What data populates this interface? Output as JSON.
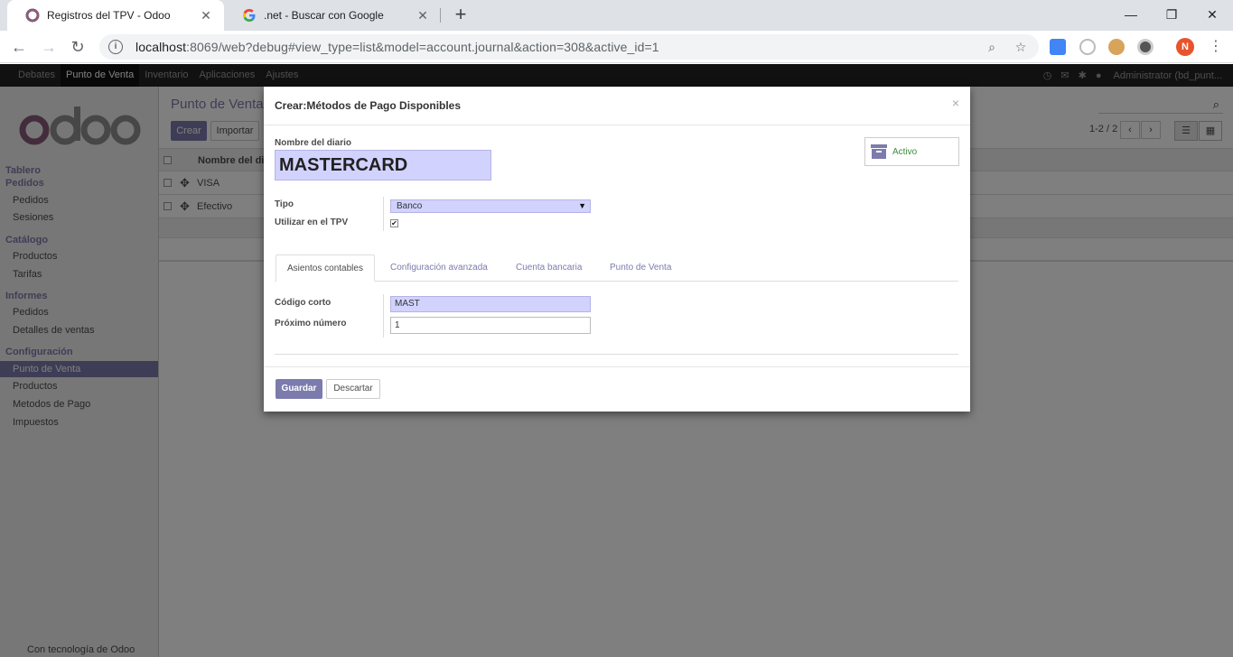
{
  "browser": {
    "tabs": [
      {
        "title": "Registros del TPV - Odoo",
        "active": true
      },
      {
        "title": ".net - Buscar con Google",
        "active": false
      }
    ],
    "url_host": "localhost",
    "url_rest": ":8069/web?debug#view_type=list&model=account.journal&action=308&active_id=1",
    "profile_initial": "N"
  },
  "topnav": {
    "items": [
      "Debates",
      "Punto de Venta",
      "Inventario",
      "Aplicaciones",
      "Ajustes"
    ],
    "active_index": 1,
    "user": "Administrator (bd_punt..."
  },
  "sidebar": {
    "sections": [
      {
        "label": "Tablero"
      },
      {
        "label": "Pedidos",
        "items": [
          "Pedidos",
          "Sesiones"
        ]
      },
      {
        "label": "Catálogo",
        "items": [
          "Productos",
          "Tarifas"
        ]
      },
      {
        "label": "Informes",
        "items": [
          "Pedidos",
          "Detalles de ventas"
        ]
      },
      {
        "label": "Configuración",
        "items": [
          "Punto de Venta",
          "Productos",
          "Metodos de Pago",
          "Impuestos"
        ]
      }
    ],
    "active_item": "Punto de Venta",
    "footer": "Con tecnología de Odoo"
  },
  "content": {
    "breadcrumb": "Punto de Venta",
    "create_label": "Crear",
    "import_label": "Importar",
    "pager": "1-2 / 2",
    "column_header": "Nombre del dia",
    "rows": [
      "VISA",
      "Efectivo"
    ]
  },
  "modal": {
    "title": "Crear:Métodos de Pago Disponibles",
    "close": "×",
    "name_label": "Nombre del diario",
    "name_value": "MASTERCARD",
    "active_label": "Activo",
    "type_label": "Tipo",
    "type_value": "Banco",
    "tpv_label": "Utilizar en el TPV",
    "tpv_checked": true,
    "tabs": [
      "Asientos contables",
      "Configuración avanzada",
      "Cuenta bancaria",
      "Punto de Venta"
    ],
    "active_tab": 0,
    "short_code_label": "Código corto",
    "short_code_value": "MAST",
    "next_number_label": "Próximo número",
    "next_number_value": "1",
    "save_label": "Guardar",
    "discard_label": "Descartar"
  },
  "colors": {
    "accent": "#7c7bad",
    "required_field": "#d2d2ff",
    "nav_bg": "#222222"
  }
}
